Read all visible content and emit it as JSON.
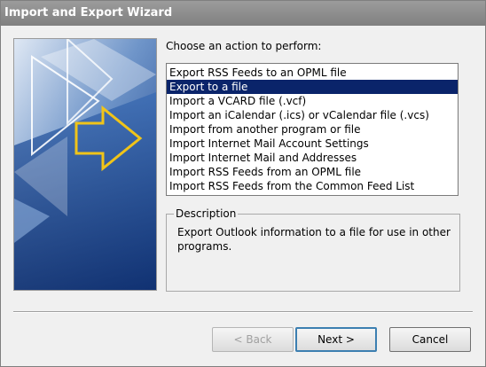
{
  "window": {
    "title": "Import and Export Wizard"
  },
  "prompt": "Choose an action to perform:",
  "actions": [
    {
      "label": "Export RSS Feeds to an OPML file",
      "selected": false
    },
    {
      "label": "Export to a file",
      "selected": true
    },
    {
      "label": "Import a VCARD file (.vcf)",
      "selected": false
    },
    {
      "label": "Import an iCalendar (.ics) or vCalendar file (.vcs)",
      "selected": false
    },
    {
      "label": "Import from another program or file",
      "selected": false
    },
    {
      "label": "Import Internet Mail Account Settings",
      "selected": false
    },
    {
      "label": "Import Internet Mail and Addresses",
      "selected": false
    },
    {
      "label": "Import RSS Feeds from an OPML file",
      "selected": false
    },
    {
      "label": "Import RSS Feeds from the Common Feed List",
      "selected": false
    }
  ],
  "description": {
    "label": "Description",
    "text": "Export Outlook information to a file for use in other programs."
  },
  "buttons": {
    "back": "< Back",
    "next": "Next >",
    "cancel": "Cancel"
  },
  "colors": {
    "selection": "#0a246a",
    "art_blue": "#1f4f9b",
    "arrow": "#f0c419"
  }
}
